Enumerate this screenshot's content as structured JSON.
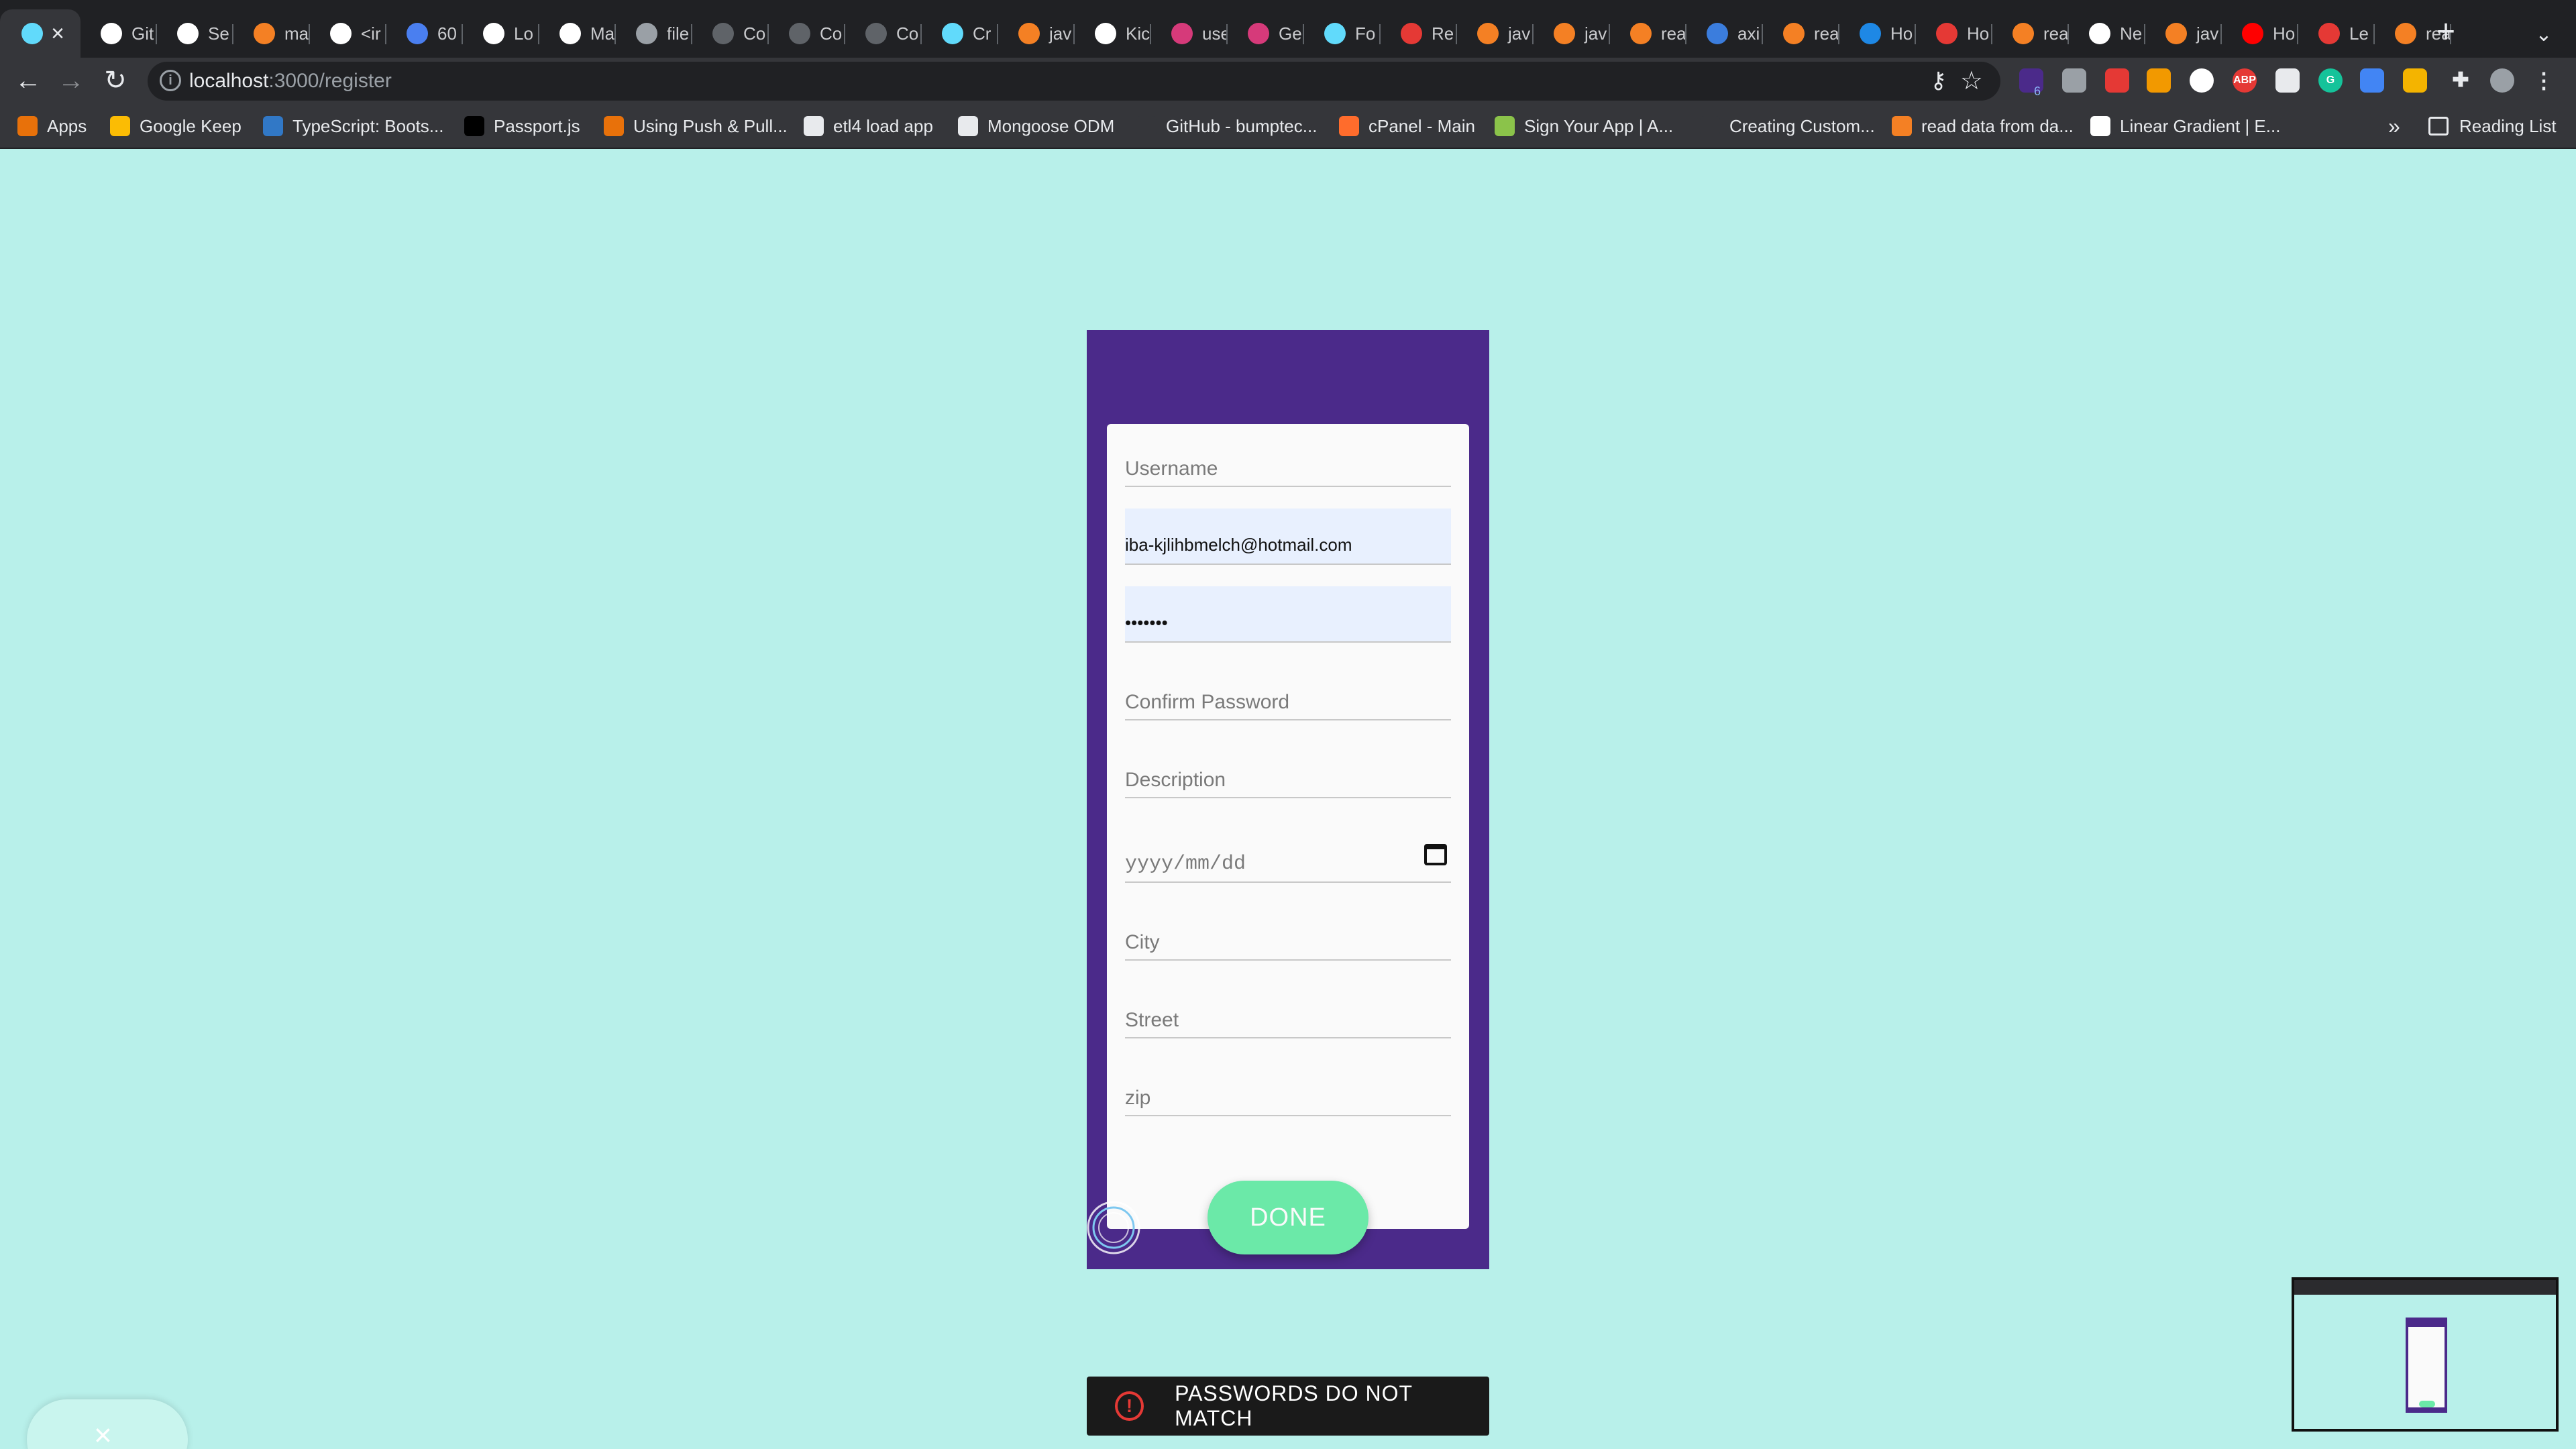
{
  "browser": {
    "tabs": [
      {
        "label": "",
        "icon": "react-icon",
        "color": "#61dafb",
        "active": true
      },
      {
        "label": "Git",
        "icon": "github-icon",
        "color": "#ffffff"
      },
      {
        "label": "Se",
        "icon": "github-icon",
        "color": "#ffffff"
      },
      {
        "label": "ma",
        "icon": "stackoverflow-icon",
        "color": "#f48024"
      },
      {
        "label": "<ir",
        "icon": "bird-icon",
        "color": "#ffffff"
      },
      {
        "label": "60",
        "icon": "f-icon",
        "color": "#4a7ff0"
      },
      {
        "label": "Lo",
        "icon": "w3schools-icon",
        "color": "#ffffff"
      },
      {
        "label": "Ma",
        "icon": "codesandbox-icon",
        "color": "#ffffff"
      },
      {
        "label": "file",
        "icon": "globe-icon",
        "color": "#9aa0a6"
      },
      {
        "label": "Co",
        "icon": "globe-icon",
        "color": "#5f6368"
      },
      {
        "label": "Co",
        "icon": "globe-icon",
        "color": "#5f6368"
      },
      {
        "label": "Co",
        "icon": "globe-icon",
        "color": "#5f6368"
      },
      {
        "label": "Cr",
        "icon": "react-icon",
        "color": "#61dafb"
      },
      {
        "label": "jav",
        "icon": "stackoverflow-icon",
        "color": "#f48024"
      },
      {
        "label": "Kic",
        "icon": "codesandbox-icon",
        "color": "#ffffff"
      },
      {
        "label": "use",
        "icon": "square-pink-icon",
        "color": "#d63a7a"
      },
      {
        "label": "Ge",
        "icon": "square-pink-icon",
        "color": "#d63a7a"
      },
      {
        "label": "Fo",
        "icon": "react-icon",
        "color": "#61dafb"
      },
      {
        "label": "Re",
        "icon": "chevron-icon",
        "color": "#e53935"
      },
      {
        "label": "jav",
        "icon": "stackoverflow-icon",
        "color": "#f48024"
      },
      {
        "label": "jav",
        "icon": "stackoverflow-icon",
        "color": "#f48024"
      },
      {
        "label": "rea",
        "icon": "stackoverflow-icon",
        "color": "#f48024"
      },
      {
        "label": "axi",
        "icon": "leaf-icon",
        "color": "#3b7ddd"
      },
      {
        "label": "rea",
        "icon": "stackoverflow-icon",
        "color": "#f48024"
      },
      {
        "label": "Ho",
        "icon": "loop-icon",
        "color": "#1e88e5"
      },
      {
        "label": "Ho",
        "icon": "record-icon",
        "color": "#e53935"
      },
      {
        "label": "rea",
        "icon": "stackoverflow-icon",
        "color": "#f48024"
      },
      {
        "label": "Ne",
        "icon": "chrome-icon",
        "color": "#ffffff"
      },
      {
        "label": "jav",
        "icon": "stackoverflow-icon",
        "color": "#f48024"
      },
      {
        "label": "Ho",
        "icon": "youtube-icon",
        "color": "#ff0000"
      },
      {
        "label": "Le",
        "icon": "c-icon",
        "color": "#e53935"
      },
      {
        "label": "rea",
        "icon": "stackoverflow-icon",
        "color": "#f48024"
      }
    ],
    "new_tab": "+",
    "tab_search": "⌄",
    "close_tab": "×",
    "url_host": "localhost",
    "url_rest": ":3000/register",
    "back": "←",
    "forward": "→",
    "reload": "↻",
    "bookmarks": [
      {
        "label": "Apps",
        "icon": "apps-grid-icon",
        "color": "#e8710a"
      },
      {
        "label": "Google Keep",
        "icon": "keep-icon",
        "color": "#fbbc04"
      },
      {
        "label": "TypeScript: Boots...",
        "icon": "ts-icon",
        "color": "#3178c6"
      },
      {
        "label": "Passport.js",
        "icon": "passport-icon",
        "color": "#000000"
      },
      {
        "label": "Using Push & Pull...",
        "icon": "arrow-icon",
        "color": "#e8710a"
      },
      {
        "label": "etl4 load app",
        "icon": "globe-icon",
        "color": "#e8eaed"
      },
      {
        "label": "Mongoose ODM",
        "icon": "globe-icon",
        "color": "#e8eaed"
      },
      {
        "label": "GitHub - bumptec...",
        "icon": "github-icon",
        "color": "#35363a"
      },
      {
        "label": "cPanel - Main",
        "icon": "cpanel-icon",
        "color": "#ff6c2c"
      },
      {
        "label": "Sign Your App | A...",
        "icon": "cloud-icon",
        "color": "#8bc34a"
      },
      {
        "label": "Creating Custom...",
        "icon": "blank-icon",
        "color": "#35363a"
      },
      {
        "label": "read data from da...",
        "icon": "stackoverflow-icon",
        "color": "#f48024"
      },
      {
        "label": "Linear Gradient | E...",
        "icon": "google-icon",
        "color": "#ffffff"
      }
    ],
    "bookmarks_more": "»",
    "reading_list": "Reading List",
    "extension_badge": "6"
  },
  "form": {
    "username_placeholder": "Username",
    "email_value": "iba-kjlihbmelch@hotmail.com",
    "password_value": "•••••••",
    "confirm_password_placeholder": "Confirm Password",
    "description_placeholder": "Description",
    "date_placeholder": "yyyy/mm/dd",
    "city_placeholder": "City",
    "street_placeholder": "Street",
    "zip_placeholder": "zip",
    "done_label": "DONE"
  },
  "toast": {
    "message": "PASSWORDS DO NOT MATCH",
    "icon": "alert-circle-icon",
    "color": "#e53935"
  },
  "bottom_pill": {
    "icon": "close-icon",
    "symbol": "×"
  },
  "colors": {
    "page_background": "#b8f0ea",
    "frame": "#4b2a8a",
    "done_button": "#6be9a8"
  }
}
